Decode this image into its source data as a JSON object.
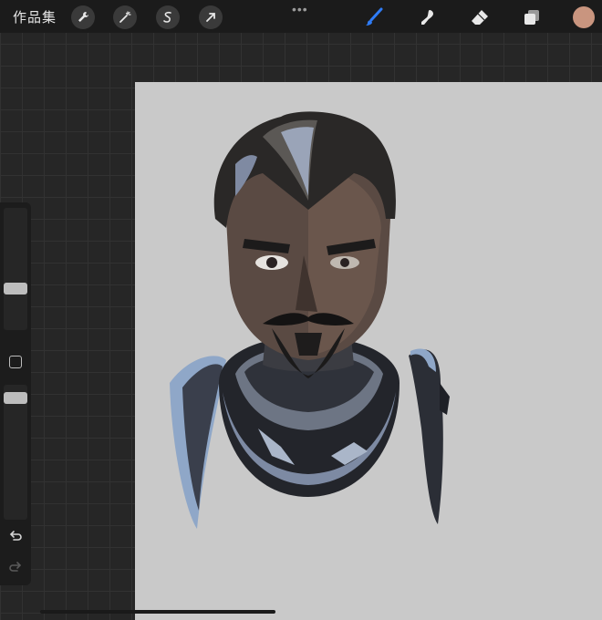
{
  "topbar": {
    "gallery_label": "作品集",
    "left_tools": [
      "wrench-icon",
      "magic-wand-icon",
      "selection-icon",
      "transform-arrow-icon"
    ],
    "more_label": "•••",
    "right_tools": [
      "brush-icon",
      "smudge-icon",
      "eraser-icon",
      "layers-icon"
    ],
    "active_tool": "brush-icon",
    "active_tool_color": "#2f7cf6",
    "current_color": "#c9957f"
  },
  "sidebar": {
    "brush_size_level": 0.55,
    "opacity_level": 0.35,
    "buttons": [
      "modify-square-button",
      "undo-button",
      "redo-button"
    ]
  },
  "canvas": {
    "background_color": "#c9c9c9",
    "artwork": "portrait-illustration"
  }
}
